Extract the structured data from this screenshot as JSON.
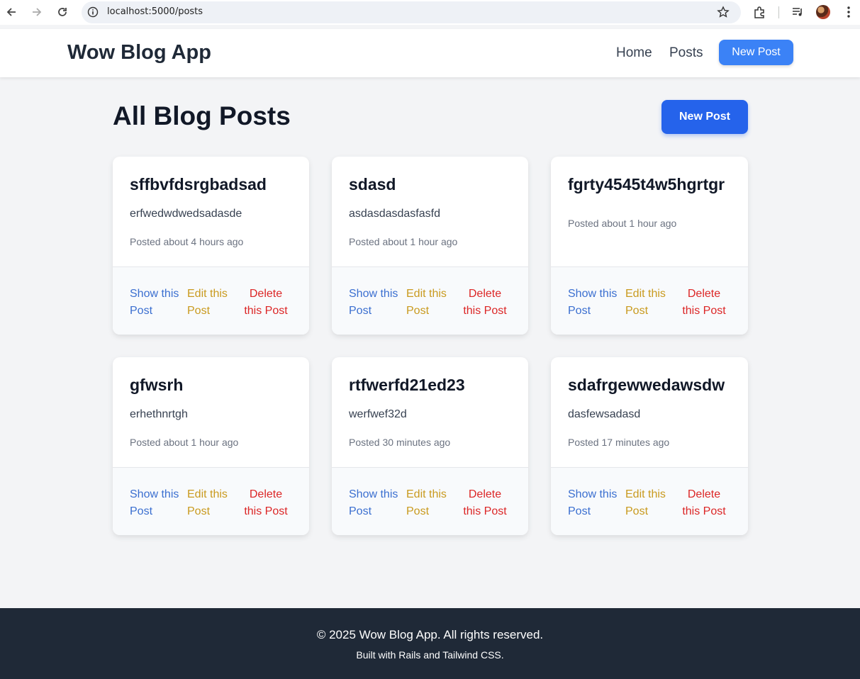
{
  "browser": {
    "url": "localhost:5000/posts",
    "icons": [
      "back-icon",
      "forward-icon",
      "reload-icon",
      "info-icon",
      "star-icon",
      "extensions-icon",
      "media-icon",
      "avatar",
      "menu-icon"
    ]
  },
  "header": {
    "brand": "Wow Blog App",
    "nav": [
      "Home",
      "Posts"
    ],
    "new_post": "New Post"
  },
  "main": {
    "title": "All Blog Posts",
    "new_post": "New Post"
  },
  "actions": {
    "show": "Show this Post",
    "edit": "Edit this Post",
    "delete": "Delete this Post"
  },
  "posts": [
    {
      "title": "sffbvfdsrgbadsad",
      "body": "erfwedwdwedsadasde",
      "posted": "Posted about 4 hours ago"
    },
    {
      "title": "sdasd",
      "body": "asdasdasdasfasfd",
      "posted": "Posted about 1 hour ago"
    },
    {
      "title": "fgrty4545t4w5hgrtgr",
      "body": "",
      "posted": "Posted about 1 hour ago"
    },
    {
      "title": "gfwsrh",
      "body": "erhethnrtgh",
      "posted": "Posted about 1 hour ago"
    },
    {
      "title": "rtfwerfd21ed23",
      "body": "werfwef32d",
      "posted": "Posted 30 minutes ago"
    },
    {
      "title": "sdafrgewwedawsdw",
      "body": "dasfewsadasd",
      "posted": "Posted 17 minutes ago"
    }
  ],
  "footer": {
    "copyright": "© 2025 Wow Blog App. All rights reserved.",
    "built_with": "Built with Rails and Tailwind CSS."
  },
  "colors": {
    "primary": "#2563eb",
    "nav_button": "#3b82f6",
    "show": "#3b6fd0",
    "edit": "#c99a1e",
    "delete": "#dc2626",
    "footer_bg": "#1f2937",
    "page_bg": "#f3f4f6"
  }
}
